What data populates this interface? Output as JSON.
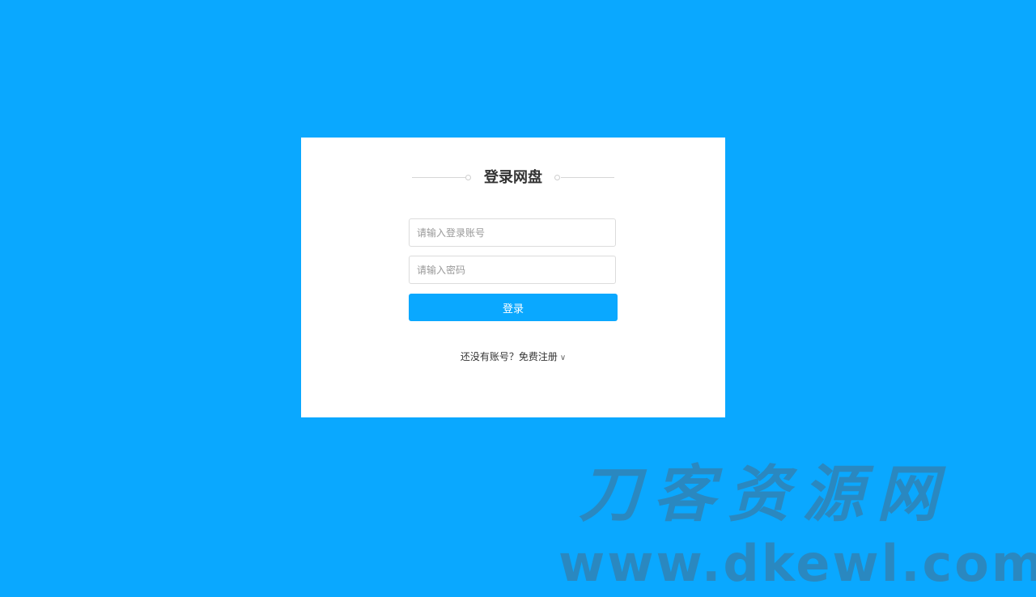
{
  "login": {
    "title": "登录网盘",
    "account_placeholder": "请输入登录账号",
    "password_placeholder": "请输入密码",
    "login_label": "登录",
    "register_prompt": "还没有账号？",
    "register_link": "免费注册",
    "register_chevron": "∨"
  },
  "watermark": {
    "name": "刀客资源网",
    "url": "www.dkewl.com"
  },
  "colors": {
    "background": "#0aa8ff",
    "card": "#ffffff",
    "button": "#0aa8ff"
  }
}
